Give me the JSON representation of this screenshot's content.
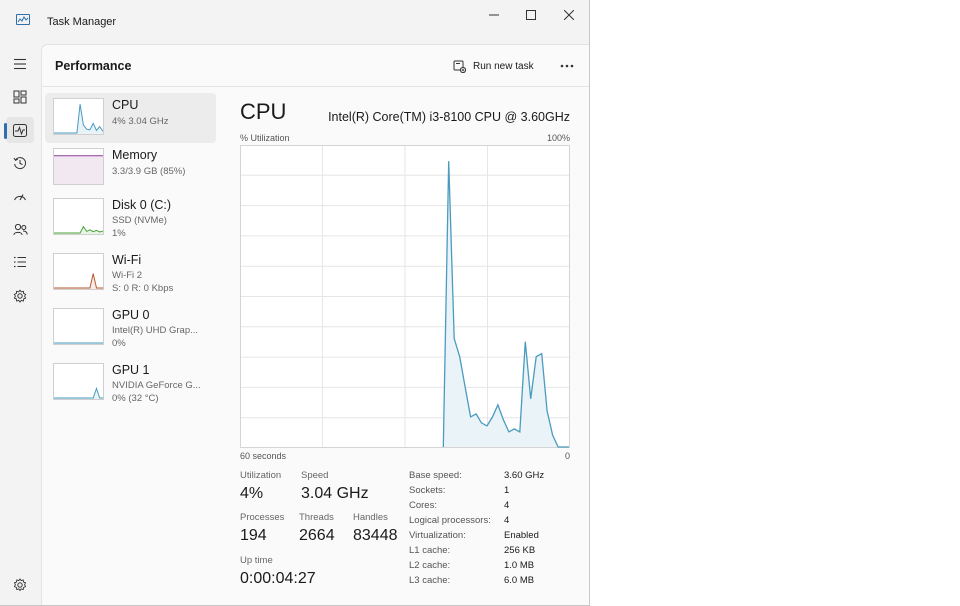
{
  "app": {
    "title": "Task Manager"
  },
  "header": {
    "title": "Performance",
    "run_new_task": "Run new task"
  },
  "nav": [
    {
      "name": "hamburger-icon"
    },
    {
      "name": "processes-icon"
    },
    {
      "name": "performance-icon",
      "active": true
    },
    {
      "name": "app-history-icon"
    },
    {
      "name": "startup-apps-icon"
    },
    {
      "name": "users-icon"
    },
    {
      "name": "details-icon"
    },
    {
      "name": "services-icon"
    },
    {
      "name": "settings-icon"
    }
  ],
  "resources": [
    {
      "name": "CPU",
      "line1": "4% 3.04 GHz",
      "line2": ""
    },
    {
      "name": "Memory",
      "line1": "3.3/3.9 GB (85%)",
      "line2": ""
    },
    {
      "name": "Disk 0 (C:)",
      "line1": "SSD (NVMe)",
      "line2": "1%"
    },
    {
      "name": "Wi-Fi",
      "line1": "Wi-Fi 2",
      "line2": "S: 0 R: 0 Kbps"
    },
    {
      "name": "GPU 0",
      "line1": "Intel(R) UHD Grap...",
      "line2": "0%"
    },
    {
      "name": "GPU 1",
      "line1": "NVIDIA GeForce G...",
      "line2": "0% (32 °C)"
    }
  ],
  "cpu": {
    "title": "CPU",
    "model": "Intel(R) Core(TM) i3-8100 CPU @ 3.60GHz",
    "util_label": "% Utilization",
    "util_max": "100%",
    "axis_left": "60 seconds",
    "axis_right": "0",
    "stats": {
      "utilization_label": "Utilization",
      "utilization": "4%",
      "speed_label": "Speed",
      "speed": "3.04 GHz",
      "processes_label": "Processes",
      "processes": "194",
      "threads_label": "Threads",
      "threads": "2664",
      "handles_label": "Handles",
      "handles": "83448",
      "uptime_label": "Up time",
      "uptime": "0:00:04:27"
    },
    "specs": [
      {
        "label": "Base speed:",
        "value": "3.60 GHz"
      },
      {
        "label": "Sockets:",
        "value": "1"
      },
      {
        "label": "Cores:",
        "value": "4"
      },
      {
        "label": "Logical processors:",
        "value": "4"
      },
      {
        "label": "Virtualization:",
        "value": "Enabled"
      },
      {
        "label": "L1 cache:",
        "value": "256 KB"
      },
      {
        "label": "L2 cache:",
        "value": "1.0 MB"
      },
      {
        "label": "L3 cache:",
        "value": "6.0 MB"
      }
    ]
  },
  "chart_data": {
    "type": "area",
    "ylabel": "% Utilization",
    "ylim": [
      0,
      100
    ],
    "xlim": [
      60,
      0
    ],
    "x": [
      60,
      59,
      58,
      57,
      56,
      55,
      54,
      53,
      52,
      51,
      50,
      49,
      48,
      47,
      46,
      45,
      44,
      43,
      42,
      41,
      40,
      39,
      38,
      37,
      36,
      35,
      34,
      33,
      32,
      31,
      30,
      29,
      28,
      27,
      26,
      25,
      24,
      23,
      22,
      21,
      20,
      19,
      18,
      17,
      16,
      15,
      14,
      13,
      12,
      11,
      10,
      9,
      8,
      7,
      6,
      5,
      4,
      3,
      2,
      1,
      0
    ],
    "values": [
      0,
      0,
      0,
      0,
      0,
      0,
      0,
      0,
      0,
      0,
      0,
      0,
      0,
      0,
      0,
      0,
      0,
      0,
      0,
      0,
      0,
      0,
      0,
      0,
      0,
      0,
      0,
      0,
      0,
      0,
      0,
      0,
      0,
      0,
      0,
      0,
      0,
      0,
      95,
      36,
      30,
      20,
      10,
      11,
      8,
      7,
      10,
      14,
      9,
      5,
      6,
      5,
      35,
      16,
      30,
      31,
      12,
      4,
      0,
      0,
      0
    ],
    "grid": true,
    "colors": {
      "line": "#4a9bbf",
      "fill": "#eaf3f8",
      "grid": "#e6e6e6"
    }
  },
  "thumbnails": {
    "CPU": {
      "color": "#4a9bbf",
      "values": [
        0,
        0,
        0,
        0,
        0,
        0,
        0,
        0,
        90,
        25,
        12,
        10,
        30,
        8,
        20,
        5
      ]
    },
    "Memory": {
      "color": "#8b3f98",
      "values": [
        85,
        85,
        85,
        85,
        85,
        85,
        85,
        85,
        85,
        85,
        85,
        85,
        85,
        85,
        85,
        85
      ]
    },
    "Disk 0 (C:)": {
      "color": "#4aa33a",
      "values": [
        0,
        0,
        0,
        0,
        0,
        0,
        0,
        0,
        0,
        20,
        5,
        10,
        4,
        8,
        3,
        6
      ]
    },
    "Wi-Fi": {
      "color": "#b55a2e",
      "values": [
        0,
        0,
        0,
        0,
        0,
        0,
        0,
        0,
        0,
        0,
        0,
        0,
        45,
        0,
        0,
        0
      ]
    },
    "GPU 0": {
      "color": "#4a9bbf",
      "values": [
        0,
        0,
        0,
        0,
        0,
        0,
        0,
        0,
        0,
        0,
        0,
        0,
        0,
        0,
        0,
        0
      ]
    },
    "GPU 1": {
      "color": "#4a9bbf",
      "values": [
        0,
        0,
        0,
        0,
        0,
        0,
        0,
        0,
        0,
        0,
        0,
        0,
        0,
        30,
        0,
        0
      ]
    }
  }
}
